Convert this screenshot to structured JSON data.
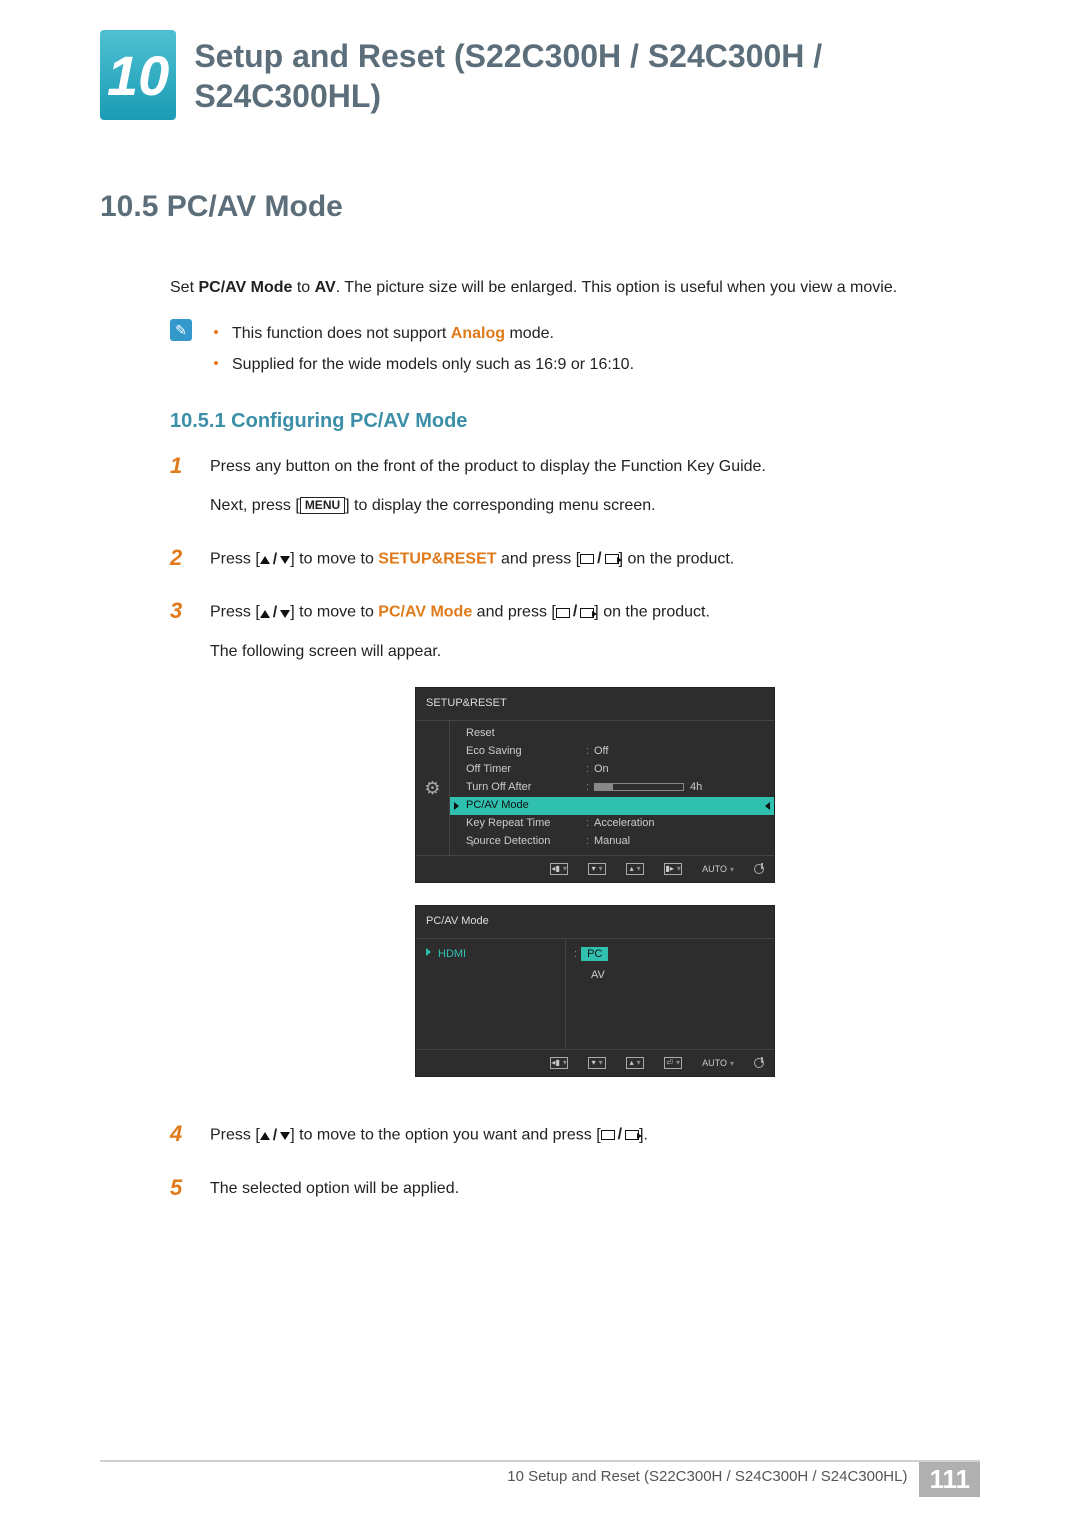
{
  "chapter": {
    "number": "10",
    "title": "Setup and Reset (S22C300H / S24C300H / S24C300HL)"
  },
  "section": {
    "number_title": "10.5 PC/AV Mode"
  },
  "intro": {
    "prefix": "Set ",
    "term": "PC/AV Mode",
    "mid": " to ",
    "mode": "AV",
    "suffix": ". The picture size will be enlarged. This option is useful when you view a movie."
  },
  "notes": {
    "item1_pre": "This function does not support ",
    "item1_term": "Analog",
    "item1_post": " mode.",
    "item2": "Supplied for the wide models only such as 16:9 or 16:10."
  },
  "subsection": {
    "title": "10.5.1 Configuring PC/AV Mode"
  },
  "steps": {
    "s1": {
      "num": "1",
      "p1": "Press any button on the front of the product to display the Function Key Guide.",
      "p2a": "Next, press [",
      "p2b": "] to display the corresponding menu screen.",
      "menu": "MENU"
    },
    "s2": {
      "num": "2",
      "pre": "Press [",
      "mid": "] to move to ",
      "target": "SETUP&RESET",
      "post1": " and press [",
      "post2": "] on the product."
    },
    "s3": {
      "num": "3",
      "pre": "Press [",
      "mid": "] to move to ",
      "target": "PC/AV Mode",
      "post1": " and press [",
      "post2": "] on the product.",
      "line2": "The following screen will appear."
    },
    "s4": {
      "num": "4",
      "pre": "Press [",
      "mid": "] to move to the option you want and press [",
      "post": "]."
    },
    "s5": {
      "num": "5",
      "text": "The selected option will be applied."
    }
  },
  "osd1": {
    "title": "SETUP&RESET",
    "rows": {
      "r1": {
        "label": "Reset",
        "value": ""
      },
      "r2": {
        "label": "Eco Saving",
        "value": "Off"
      },
      "r3": {
        "label": "Off Timer",
        "value": "On"
      },
      "r4": {
        "label": "Turn Off After",
        "value": "4h"
      },
      "r5": {
        "label": "PC/AV Mode",
        "value": ""
      },
      "r6": {
        "label": "Key Repeat Time",
        "value": "Acceleration"
      },
      "r7": {
        "label": "Source Detection",
        "value": "Manual"
      }
    },
    "footer_auto": "AUTO"
  },
  "osd2": {
    "title": "PC/AV Mode",
    "left_item": "HDMI",
    "opt1": "PC",
    "opt2": "AV",
    "footer_auto": "AUTO"
  },
  "footer": {
    "text": "10 Setup and Reset (S22C300H / S24C300H / S24C300HL)",
    "page": "111"
  }
}
